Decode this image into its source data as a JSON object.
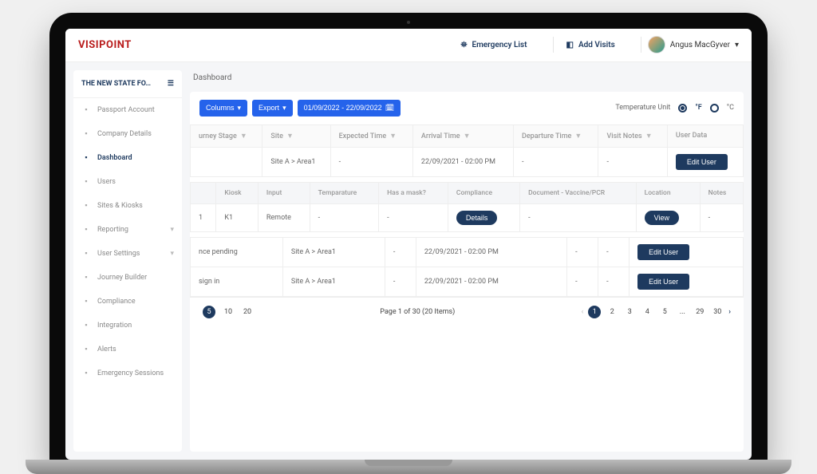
{
  "brand": "VISIPOINT",
  "topbar": {
    "emergency_list": "Emergency List",
    "add_visits": "Add Visits",
    "user_name": "Angus MacGyver"
  },
  "sidebar": {
    "title": "THE NEW STATE FO…",
    "items": [
      {
        "label": "Passport Account",
        "icon": "badge"
      },
      {
        "label": "Company Details",
        "icon": "building"
      },
      {
        "label": "Dashboard",
        "icon": "home",
        "active": true
      },
      {
        "label": "Users",
        "icon": "users"
      },
      {
        "label": "Sites & Kiosks",
        "icon": "site"
      },
      {
        "label": "Reporting",
        "icon": "report",
        "expand": true
      },
      {
        "label": "User Settings",
        "icon": "settings",
        "expand": true
      },
      {
        "label": "Journey Builder",
        "icon": "journey"
      },
      {
        "label": "Compliance",
        "icon": "compliance"
      },
      {
        "label": "Integration",
        "icon": "integration"
      },
      {
        "label": "Alerts",
        "icon": "bell"
      },
      {
        "label": "Emergency Sessions",
        "icon": "emergency"
      }
    ]
  },
  "page_title": "Dashboard",
  "toolbar": {
    "columns": "Columns",
    "export": "Export",
    "date_range": "01/09/2022 - 22/09/2022",
    "temp_label": "Temperature Unit",
    "unit_f": "°F",
    "unit_c": "°C"
  },
  "main_table": {
    "headers": [
      "urney Stage",
      "Site",
      "Expected Time",
      "Arrival Time",
      "Departure Time",
      "Visit Notes",
      "User Data"
    ],
    "filterable": [
      true,
      true,
      true,
      true,
      true,
      true,
      false
    ],
    "rows": [
      {
        "stage": "",
        "site": "Site A > Area1",
        "expected": "-",
        "arrival": "22/09/2021 - 02:00 PM",
        "departure": "-",
        "notes": "-",
        "action": "Edit User"
      }
    ],
    "rows_bottom": [
      {
        "stage": "nce pending",
        "site": "Site A > Area1",
        "expected": "-",
        "arrival": "22/09/2021 - 02:00 PM",
        "departure": "-",
        "notes": "-",
        "action": "Edit User"
      },
      {
        "stage": "sign in",
        "site": "Site A > Area1",
        "expected": "-",
        "arrival": "22/09/2021 - 02:00 PM",
        "departure": "-",
        "notes": "-",
        "action": "Edit User"
      }
    ]
  },
  "sub_table": {
    "headers": [
      "",
      "Kiosk",
      "Input",
      "Temparature",
      "Has a mask?",
      "Compliance",
      "Document - Vaccine/PCR",
      "Location",
      "Notes"
    ],
    "row": {
      "idx": "1",
      "kiosk": "K1",
      "input": "Remote",
      "temp": "-",
      "mask": "-",
      "compliance": "Details",
      "doc": "-",
      "location": "View",
      "notes": "-"
    }
  },
  "pagination": {
    "sizes": [
      "5",
      "10",
      "20"
    ],
    "active_size": "5",
    "summary": "Page 1 of 30 (20 Items)",
    "pages": [
      "1",
      "2",
      "3",
      "4",
      "5",
      "...",
      "29",
      "30"
    ],
    "active_page": "1"
  }
}
